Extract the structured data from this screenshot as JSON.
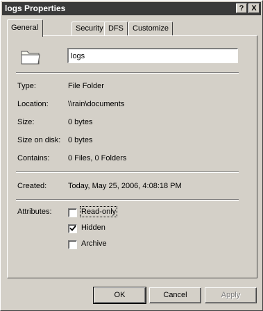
{
  "window": {
    "title": "logs Properties",
    "help_label": "?",
    "close_label": "X"
  },
  "tabs": [
    {
      "label": "General",
      "active": true
    },
    {
      "label": "Security",
      "active": false
    },
    {
      "label": "DFS",
      "active": false
    },
    {
      "label": "Customize",
      "active": false
    }
  ],
  "general": {
    "folder_icon": "folder-icon",
    "name_value": "logs",
    "properties": [
      {
        "label": "Type:",
        "value": "File Folder"
      },
      {
        "label": "Location:",
        "value": "\\\\rain\\documents"
      },
      {
        "label": "Size:",
        "value": "0 bytes"
      },
      {
        "label": "Size on disk:",
        "value": "0 bytes"
      },
      {
        "label": "Contains:",
        "value": "0 Files, 0 Folders"
      }
    ],
    "created_label": "Created:",
    "created_value": "Today, May 25, 2006, 4:08:18 PM",
    "attributes_label": "Attributes:",
    "attributes": [
      {
        "label": "Read-only",
        "checked": false
      },
      {
        "label": "Hidden",
        "checked": true
      },
      {
        "label": "Archive",
        "checked": false
      }
    ]
  },
  "buttons": {
    "ok": "OK",
    "cancel": "Cancel",
    "apply": "Apply"
  }
}
